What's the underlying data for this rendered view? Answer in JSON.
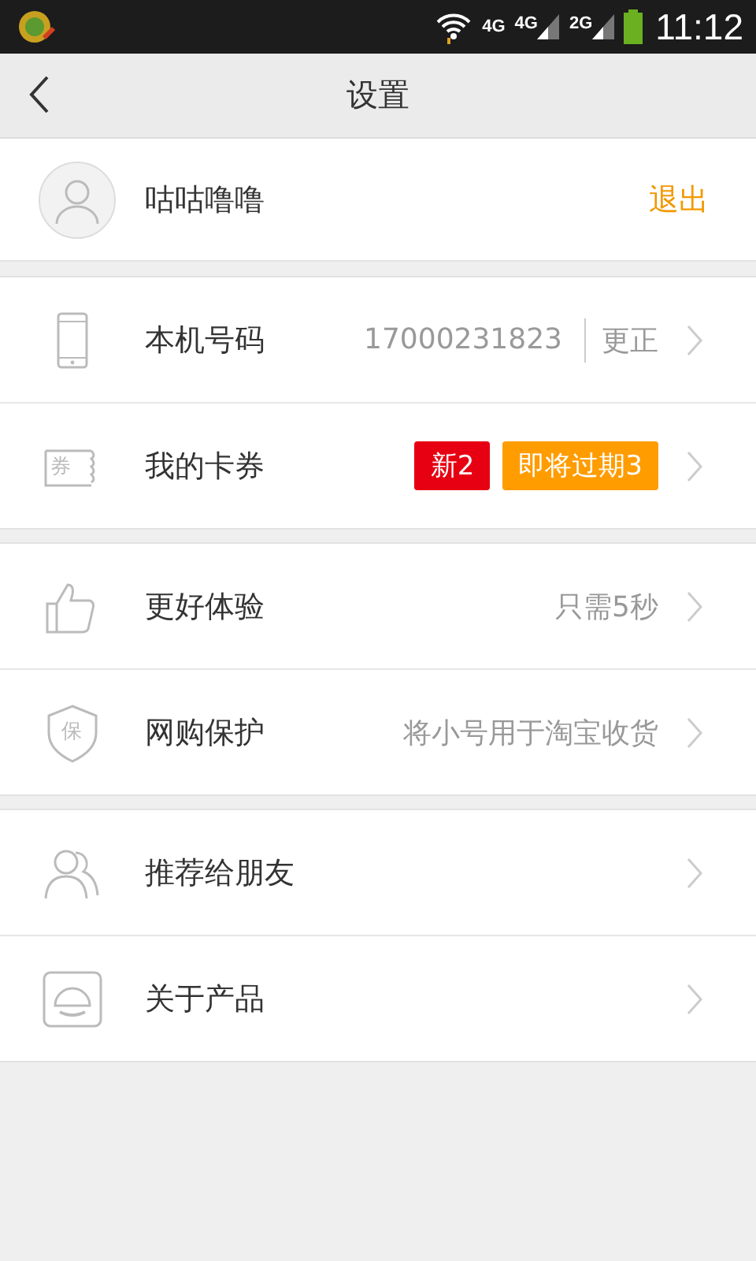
{
  "status_bar": {
    "network_labels": [
      "4G",
      "4G",
      "2G"
    ],
    "time": "11:12"
  },
  "header": {
    "title": "设置"
  },
  "profile": {
    "name": "咕咕噜噜",
    "action": "退出"
  },
  "sections": [
    {
      "rows": [
        {
          "kind": "phone",
          "label": "本机号码",
          "value": "17000231823",
          "action": "更正"
        },
        {
          "kind": "coupon",
          "icon_text": "券",
          "label": "我的卡券",
          "badges": [
            {
              "text": "新2",
              "color": "#e60012"
            },
            {
              "text": "即将过期3",
              "color": "#ff9c00"
            }
          ]
        }
      ]
    },
    {
      "rows": [
        {
          "kind": "thumb",
          "label": "更好体验",
          "value": "只需5秒"
        },
        {
          "kind": "shield",
          "icon_text": "保",
          "label": "网购保护",
          "value": "将小号用于淘宝收货"
        }
      ]
    },
    {
      "rows": [
        {
          "kind": "people",
          "label": "推荐给朋友"
        },
        {
          "kind": "product",
          "label": "关于产品"
        }
      ]
    }
  ]
}
